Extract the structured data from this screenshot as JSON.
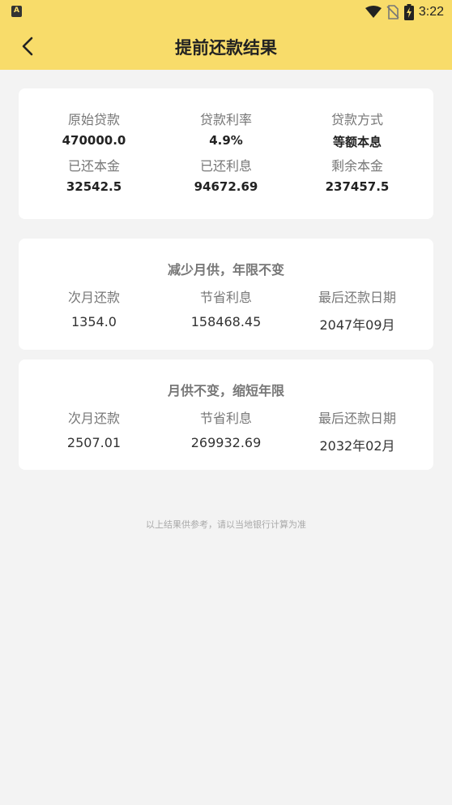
{
  "status_bar": {
    "app_badge": "A",
    "time": "3:22"
  },
  "header": {
    "title": "提前还款结果"
  },
  "summary": {
    "row1": [
      {
        "label": "原始贷款",
        "value": "470000.0"
      },
      {
        "label": "贷款利率",
        "value": "4.9%"
      },
      {
        "label": "贷款方式",
        "value": "等额本息"
      }
    ],
    "row2": [
      {
        "label": "已还本金",
        "value": "32542.5"
      },
      {
        "label": "已还利息",
        "value": "94672.69"
      },
      {
        "label": "剩余本金",
        "value": "237457.5"
      }
    ]
  },
  "option1": {
    "title": "减少月供，年限不变",
    "items": [
      {
        "label": "次月还款",
        "value": "1354.0"
      },
      {
        "label": "节省利息",
        "value": "158468.45"
      },
      {
        "label": "最后还款日期",
        "value": "2047年09月"
      }
    ]
  },
  "option2": {
    "title": "月供不变，缩短年限",
    "items": [
      {
        "label": "次月还款",
        "value": "2507.01"
      },
      {
        "label": "节省利息",
        "value": "269932.69"
      },
      {
        "label": "最后还款日期",
        "value": "2032年02月"
      }
    ]
  },
  "footer": {
    "note": "以上结果供参考，请以当地银行计算为准"
  },
  "colors": {
    "header_bg": "#f8dc6a",
    "page_bg": "#f3f3f3",
    "card_bg": "#ffffff"
  }
}
